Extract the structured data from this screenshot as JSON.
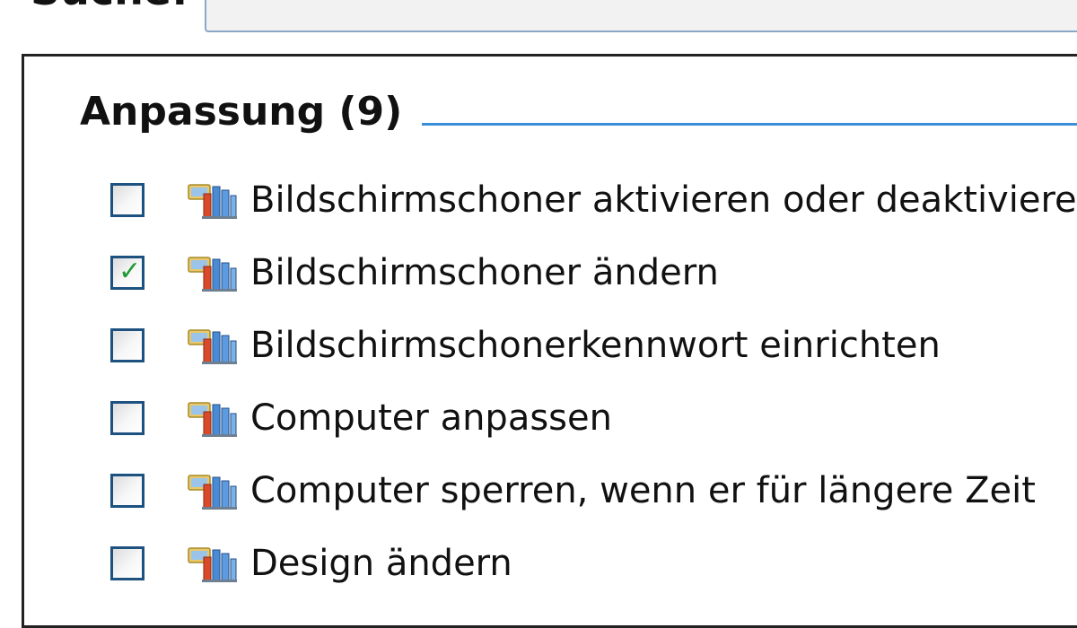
{
  "search": {
    "label": "Suche:",
    "value": "",
    "placeholder": ""
  },
  "group": {
    "title": "Anpassung (9)"
  },
  "items": [
    {
      "label": "Bildschirmschoner aktivieren oder deaktivieren",
      "checked": false,
      "icon": "control-panel-icon"
    },
    {
      "label": "Bildschirmschoner ändern",
      "checked": true,
      "icon": "control-panel-icon"
    },
    {
      "label": "Bildschirmschonerkennwort einrichten",
      "checked": false,
      "icon": "control-panel-icon"
    },
    {
      "label": "Computer anpassen",
      "checked": false,
      "icon": "control-panel-icon"
    },
    {
      "label": "Computer sperren, wenn er für längere Zeit",
      "checked": false,
      "icon": "control-panel-icon"
    },
    {
      "label": "Design ändern",
      "checked": false,
      "icon": "control-panel-icon"
    }
  ],
  "colors": {
    "group_rule": "#3b8fd8",
    "checkbox_border": "#1c5180",
    "checkmark": "#1f9a36",
    "search_border": "#8aa7c7"
  }
}
